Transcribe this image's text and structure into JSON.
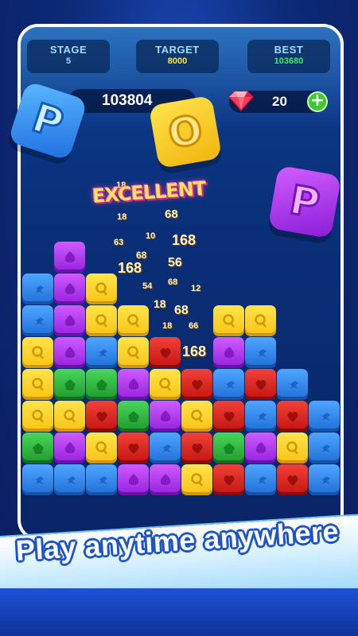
{
  "stats": {
    "stage": {
      "label": "STAGE",
      "value": "5"
    },
    "target": {
      "label": "TARGET",
      "value": "8000"
    },
    "best": {
      "label": "BEST",
      "value": "103680"
    }
  },
  "score": "103804",
  "gems": "20",
  "plus_label": "+",
  "title_letters": [
    "P",
    "O",
    "P"
  ],
  "praise": "EXCELLENT",
  "score_popups": [
    "18",
    "68",
    "18",
    "63",
    "10",
    "168",
    "68",
    "56",
    "168",
    "54",
    "68",
    "12",
    "18",
    "68",
    "18",
    "66",
    "168"
  ],
  "board": {
    "columns": 10,
    "rows": [
      [
        "",
        "purple",
        "",
        "",
        "",
        "",
        "",
        "",
        "",
        ""
      ],
      [
        "blue",
        "purple",
        "yellow",
        "",
        "",
        "",
        "",
        "",
        "",
        ""
      ],
      [
        "blue",
        "purple",
        "yellow",
        "yellow",
        "",
        "",
        "yellow",
        "yellow",
        "",
        ""
      ],
      [
        "yellow",
        "purple",
        "blue",
        "yellow",
        "red",
        "",
        "purple",
        "blue",
        "",
        ""
      ],
      [
        "yellow",
        "green",
        "green",
        "purple",
        "yellow",
        "red",
        "blue",
        "red",
        "blue",
        ""
      ],
      [
        "yellow",
        "yellow",
        "red",
        "green",
        "purple",
        "yellow",
        "red",
        "blue",
        "red",
        "blue"
      ],
      [
        "green",
        "purple",
        "yellow",
        "red",
        "blue",
        "red",
        "green",
        "purple",
        "yellow",
        "blue"
      ],
      [
        "blue",
        "blue",
        "blue",
        "purple",
        "purple",
        "yellow",
        "red",
        "blue",
        "red",
        "blue"
      ]
    ]
  },
  "colors": {
    "blue": "#3a8ef0",
    "purple": "#b63ef0",
    "yellow": "#fbd22e",
    "green": "#33b844",
    "red": "#dc2a22"
  },
  "tagline": "Play anytime anywhere"
}
